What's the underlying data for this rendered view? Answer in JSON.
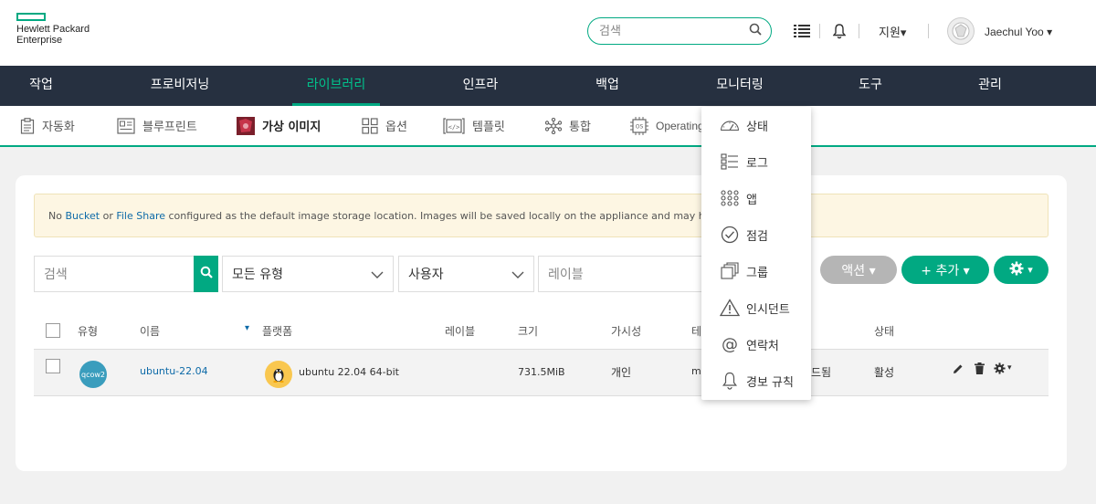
{
  "header": {
    "logo_line1": "Hewlett Packard",
    "logo_line2": "Enterprise",
    "search_placeholder": "검색",
    "support_label": "지원▾",
    "user_name": "Jaechul Yoo ▾"
  },
  "main_nav": {
    "items": [
      {
        "label": "작업"
      },
      {
        "label": "프로비저닝"
      },
      {
        "label": "라이브러리"
      },
      {
        "label": "인프라"
      },
      {
        "label": "백업"
      },
      {
        "label": "모니터링"
      },
      {
        "label": "도구"
      },
      {
        "label": "관리"
      }
    ]
  },
  "sub_nav": {
    "items": [
      {
        "label": "자동화",
        "icon": "clipboard-icon"
      },
      {
        "label": "블루프린트",
        "icon": "blueprint-icon"
      },
      {
        "label": "가상 이미지",
        "icon": "virtual-image-icon"
      },
      {
        "label": "옵션",
        "icon": "options-icon"
      },
      {
        "label": "템플릿",
        "icon": "template-icon"
      },
      {
        "label": "통합",
        "icon": "integration-icon"
      },
      {
        "label": "Operating",
        "icon": "os-icon"
      }
    ]
  },
  "alert": {
    "prefix": "No ",
    "bucket": "Bucket",
    "or": " or ",
    "file_share": "File Share",
    "suffix": " configured as the default image storage location. Images will be saved locally on the appliance and may have limit"
  },
  "filters": {
    "search_placeholder": "검색",
    "type_value": "모든 유형",
    "user_value": "사용자",
    "label_placeholder": "레이블"
  },
  "buttons": {
    "actions": "액션 ▾",
    "add": "+ 추가 ▾",
    "settings_caret": "▾"
  },
  "table": {
    "columns": {
      "type": "유형",
      "name": "이름",
      "sort_caret": "▾",
      "platform": "플랫폼",
      "labels": "레이블",
      "size": "크기",
      "visibility": "가시성",
      "tenant_partial": "테",
      "status": "상태"
    },
    "rows": [
      {
        "type_badge": "qcow2",
        "name": "ubuntu-22.04",
        "platform": "ubuntu 22.04 64-bit",
        "size": "731.5MiB",
        "visibility": "개인",
        "tenant_partial": "mo",
        "sync_partial": "드됨",
        "status": "활성"
      }
    ]
  },
  "monitoring_menu": {
    "items": [
      {
        "label": "상태",
        "icon": "gauge-icon"
      },
      {
        "label": "로그",
        "icon": "log-icon"
      },
      {
        "label": "앱",
        "icon": "apps-grid-icon"
      },
      {
        "label": "점검",
        "icon": "check-circle-icon"
      },
      {
        "label": "그룹",
        "icon": "group-icon"
      },
      {
        "label": "인시던트",
        "icon": "warning-icon"
      },
      {
        "label": "연락처",
        "icon": "at-icon"
      },
      {
        "label": "경보 규칙",
        "icon": "bell-icon"
      }
    ]
  },
  "colors": {
    "accent": "#01a982",
    "nav_bg": "#263040",
    "alert_bg": "#fdf6e3",
    "pill_gray": "#b5b5b5"
  }
}
